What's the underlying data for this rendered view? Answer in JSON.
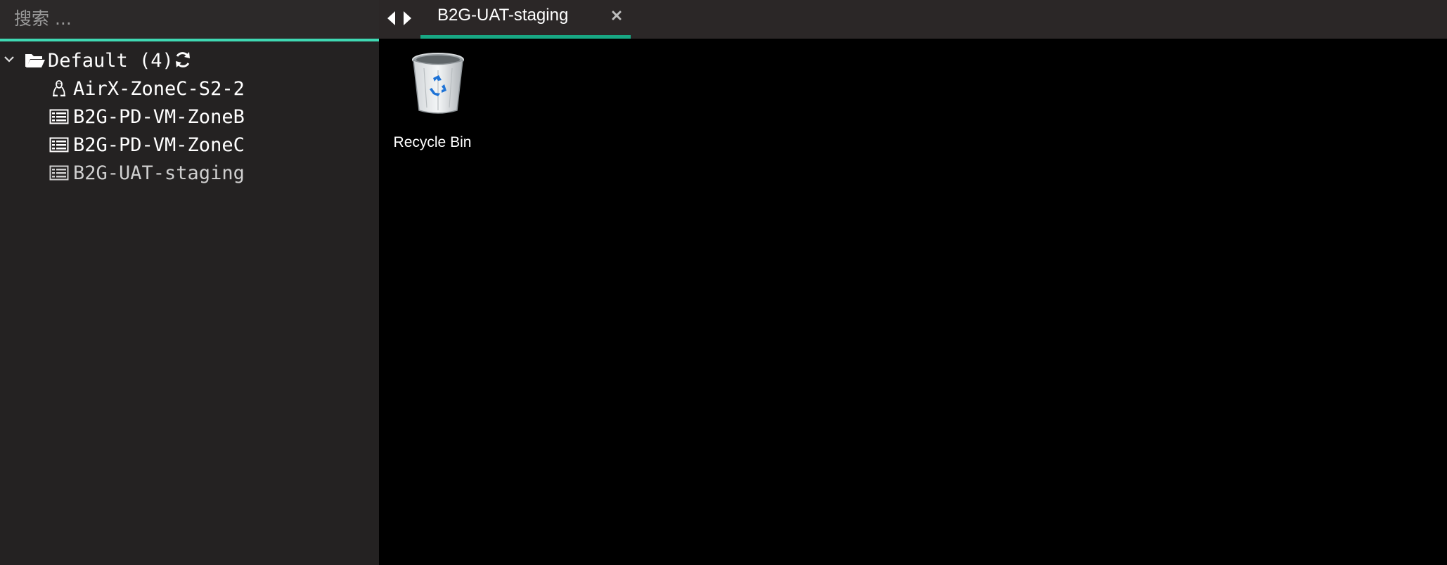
{
  "search": {
    "placeholder": "搜索 ..."
  },
  "tree": {
    "group": {
      "label": "Default (4)",
      "expanded": true,
      "icon": "folder-open-icon"
    },
    "items": [
      {
        "label": "AirX-ZoneC-S2-2",
        "icon": "linux-icon"
      },
      {
        "label": "B2G-PD-VM-ZoneB",
        "icon": "server-icon"
      },
      {
        "label": "B2G-PD-VM-ZoneC",
        "icon": "server-icon"
      },
      {
        "label": "B2G-UAT-staging",
        "icon": "server-icon"
      }
    ]
  },
  "tabs": [
    {
      "label": "B2G-UAT-staging",
      "active": true
    }
  ],
  "desktop": {
    "icons": [
      {
        "label": "Recycle Bin",
        "icon": "recycle-bin-icon"
      }
    ]
  },
  "colors": {
    "accent": "#3fd9b3",
    "tab_underline": "#18a884",
    "sidebar_bg": "#242222",
    "tabbar_bg": "#2b2727",
    "desktop_bg": "#000000"
  }
}
